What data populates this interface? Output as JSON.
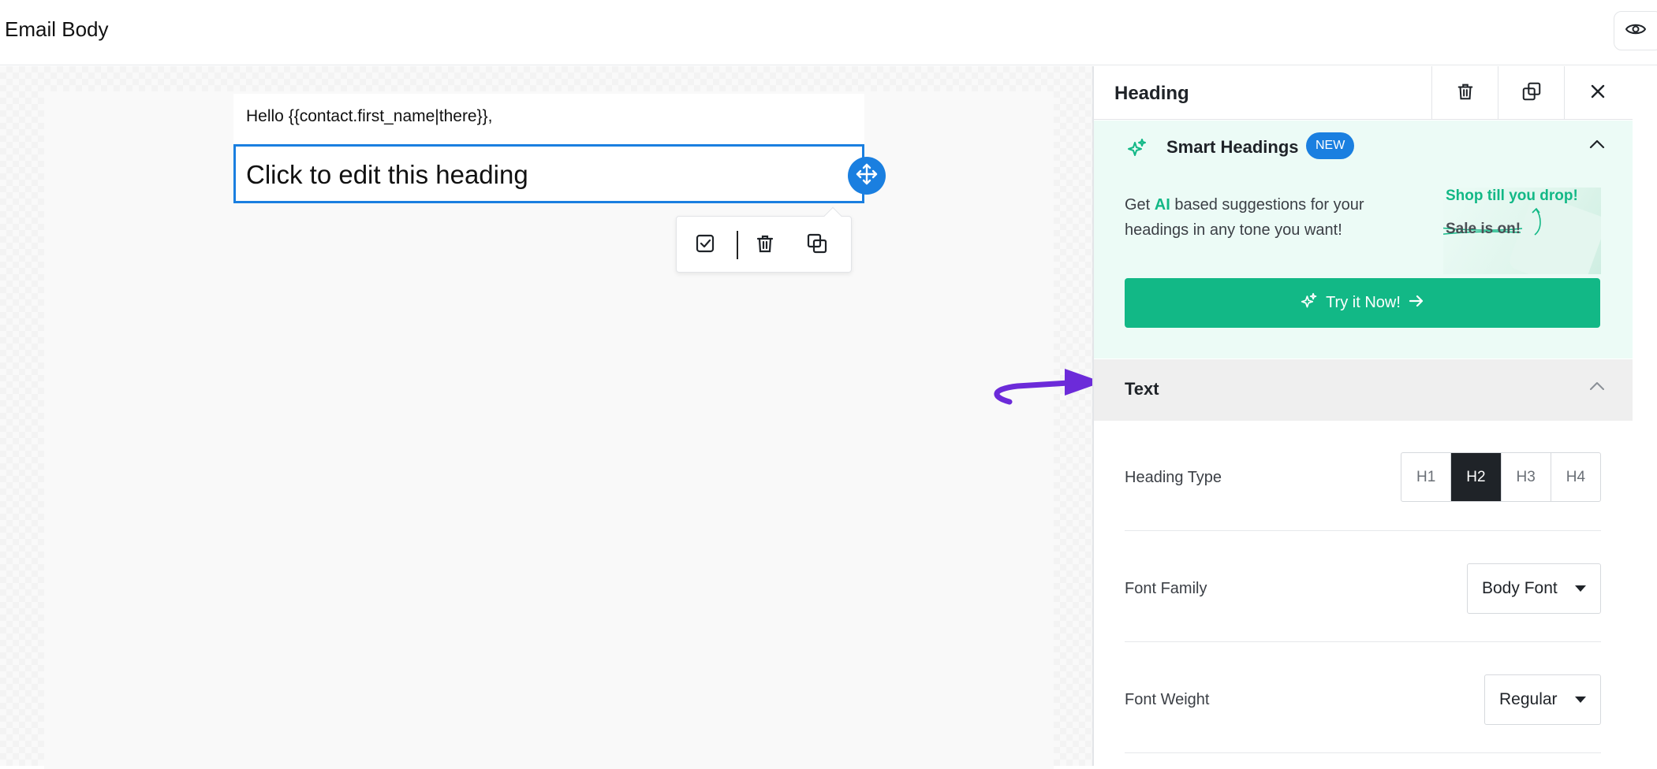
{
  "topbar": {
    "title": "Email Body",
    "preview_icon": "eye-icon"
  },
  "canvas": {
    "greeting": "Hello {{contact.first_name|there}},",
    "heading": "Click to edit this heading",
    "toolbar_icons": [
      "checkbox-icon",
      "trash-icon",
      "duplicate-icon"
    ]
  },
  "panel": {
    "title": "Heading",
    "header_icons": [
      "trash-icon",
      "duplicate-icon",
      "close-icon"
    ],
    "smart": {
      "title": "Smart Headings",
      "badge": "NEW",
      "desc_prefix": "Get ",
      "desc_ai": "AI",
      "desc_suffix": " based suggestions for your headings in any tone you want!",
      "promo_line1": "Shop till you drop!",
      "promo_line2": "Sale is on!",
      "button": "Try it Now!",
      "accent": "#12b886"
    },
    "text_section": {
      "label": "Text"
    },
    "heading_type": {
      "label": "Heading Type",
      "options": [
        "H1",
        "H2",
        "H3",
        "H4"
      ],
      "selected": "H2"
    },
    "font_family": {
      "label": "Font Family",
      "value": "Body Font"
    },
    "font_weight": {
      "label": "Font Weight",
      "value": "Regular"
    }
  },
  "colors": {
    "primary_blue": "#1a7fe0",
    "arrow_purple": "#6c2bd9"
  }
}
